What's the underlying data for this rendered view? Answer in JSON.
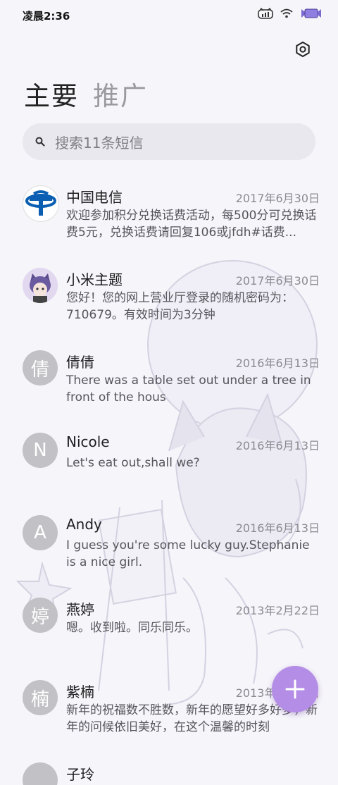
{
  "status_bar": {
    "time": "凌晨2:36",
    "icons": [
      "cat-signal-icon",
      "wifi-icon",
      "battery-icon"
    ]
  },
  "header": {
    "settings_icon": "gear-icon",
    "tabs": [
      {
        "label": "主要",
        "active": true
      },
      {
        "label": "推广",
        "active": false
      }
    ]
  },
  "search": {
    "placeholder": "搜索11条短信"
  },
  "conversations": [
    {
      "name": "中国电信",
      "date": "2017年6月30日",
      "preview": "欢迎参加积分兑换话费活动，每500分可兑换话费5元，兑换话费请回复106或jfdh#话费...",
      "avatar": "china-telecom-logo"
    },
    {
      "name": "小米主题",
      "date": "2017年6月30日",
      "preview": "您好！您的网上营业厅登录的随机密码为：710679。有效时间为3分钟",
      "avatar": "anime-cat-avatar"
    },
    {
      "name": "倩倩",
      "date": "2016年6月13日",
      "preview": "There was a table set out under a tree in front of the hous",
      "avatar_letter": "倩"
    },
    {
      "name": "Nicole",
      "date": "2016年6月13日",
      "preview": "Let's eat out,shall we?",
      "avatar_letter": "N"
    },
    {
      "name": "Andy",
      "date": "2016年6月13日",
      "preview": "I guess you're some lucky guy.Stephanie is a nice girl.",
      "avatar_letter": "A"
    },
    {
      "name": "燕婷",
      "date": "2013年2月22日",
      "preview": "嗯。收到啦。同乐同乐。",
      "avatar_letter": "婷"
    },
    {
      "name": "紫楠",
      "date": "2013年2月22日",
      "preview": "新年的祝福数不胜数，新年的愿望好多好多，新年的问候依旧美好，在这个温馨的时刻",
      "avatar_letter": "楠"
    },
    {
      "name": "子玲",
      "date": "",
      "preview": "",
      "avatar_letter": ""
    }
  ],
  "fab": {
    "icon": "plus-icon"
  },
  "colors": {
    "accent": "#b48de6",
    "background": "#f6f5fa",
    "avatar_gray": "#c2c1c6",
    "telecom_blue": "#0b5fb3"
  }
}
